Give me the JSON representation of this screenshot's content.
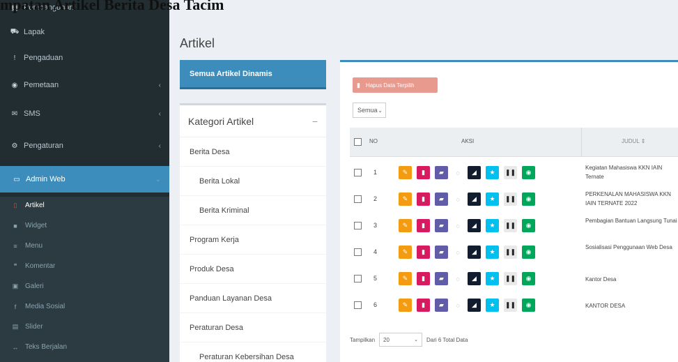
{
  "overlay": {
    "title": "mpatan Artikel Berita Desa Tacim"
  },
  "sidebar": {
    "items": [
      {
        "label": "Pembangunan",
        "icon": "building-icon",
        "glyph": "▦"
      },
      {
        "label": "Lapak",
        "icon": "cart-icon",
        "glyph": "⛟"
      },
      {
        "label": "Pengaduan",
        "icon": "exclamation-icon",
        "glyph": "!"
      },
      {
        "label": "Pemetaan",
        "icon": "globe-icon",
        "glyph": "◉",
        "chevron": "‹"
      },
      {
        "label": "SMS",
        "icon": "envelope-icon",
        "glyph": "✉",
        "chevron": "‹"
      },
      {
        "label": "Pengaturan",
        "icon": "gears-icon",
        "glyph": "⚙",
        "chevron": "‹"
      },
      {
        "label": "Admin Web",
        "icon": "desktop-icon",
        "glyph": "▭",
        "chevron": "⌄"
      }
    ],
    "subitems": [
      {
        "label": "Artikel",
        "icon": "file-icon",
        "glyph": "▯"
      },
      {
        "label": "Widget",
        "icon": "widget-icon",
        "glyph": "■"
      },
      {
        "label": "Menu",
        "icon": "list-icon",
        "glyph": "≡"
      },
      {
        "label": "Komentar",
        "icon": "comments-icon",
        "glyph": "❝"
      },
      {
        "label": "Galeri",
        "icon": "image-icon",
        "glyph": "▣"
      },
      {
        "label": "Media Sosial",
        "icon": "facebook-icon",
        "glyph": "f"
      },
      {
        "label": "Slider",
        "icon": "slider-icon",
        "glyph": "▤"
      },
      {
        "label": "Teks Berjalan",
        "icon": "arrows-icon",
        "glyph": "↔"
      }
    ]
  },
  "content": {
    "page_title": "Artikel",
    "dynamic_button": "Semua Artikel Dinamis",
    "category_box": {
      "title": "Kategori Artikel",
      "collapse": "−",
      "items": [
        {
          "label": "Berita Desa",
          "indent": false
        },
        {
          "label": "Berita Lokal",
          "indent": true
        },
        {
          "label": "Berita Kriminal",
          "indent": true
        },
        {
          "label": "Program Kerja",
          "indent": false
        },
        {
          "label": "Produk Desa",
          "indent": false
        },
        {
          "label": "Panduan Layanan Desa",
          "indent": false
        },
        {
          "label": "Peraturan Desa",
          "indent": false
        },
        {
          "label": "Peraturan Kebersihan Desa",
          "indent": true
        }
      ]
    },
    "table": {
      "delete_selected": "Hapus Data Terpilih",
      "filter": {
        "value": "Semua"
      },
      "headers": {
        "no": "NO",
        "aksi": "AKSI",
        "judul": "JUDUL ⇕"
      },
      "action_buttons": [
        {
          "name": "edit-button",
          "icon": "edit-icon",
          "glyph": "✎",
          "color": "#f39c12"
        },
        {
          "name": "delete-button",
          "icon": "trash-icon",
          "glyph": "▮",
          "color": "#d81b60"
        },
        {
          "name": "category-button",
          "icon": "folder-icon",
          "glyph": "▰",
          "color": "#605ca8"
        },
        {
          "name": "comment-button",
          "icon": "comment-icon",
          "glyph": "◌",
          "color": "plain"
        },
        {
          "name": "toggle-button",
          "icon": "unlock-icon",
          "glyph": "◢",
          "color": "#111c2e"
        },
        {
          "name": "highlight-button",
          "icon": "star-icon",
          "glyph": "★",
          "color": "#00c0ef"
        },
        {
          "name": "pause-button",
          "icon": "pause-icon",
          "glyph": "❚❚",
          "color": "gray"
        },
        {
          "name": "view-button",
          "icon": "eye-icon",
          "glyph": "◉",
          "color": "#00a65a"
        }
      ],
      "rows": [
        {
          "no": "1",
          "title": "Kegiatan Mahasiswa KKN IAIN Ternate"
        },
        {
          "no": "2",
          "title": "PERKENALAN MAHASISWA KKN IAIN TERNATE 2022"
        },
        {
          "no": "3",
          "title": "Pembagian Bantuan Langsung Tunai"
        },
        {
          "no": "4",
          "title": "Sosialisasi Penggunaan Web Desa"
        },
        {
          "no": "5",
          "title": "Kantor Desa"
        },
        {
          "no": "6",
          "title": "KANTOR DESA"
        }
      ],
      "footer": {
        "show_label": "Tampilkan",
        "page_length": "20",
        "info": "Dari 6 Total Data"
      }
    }
  }
}
